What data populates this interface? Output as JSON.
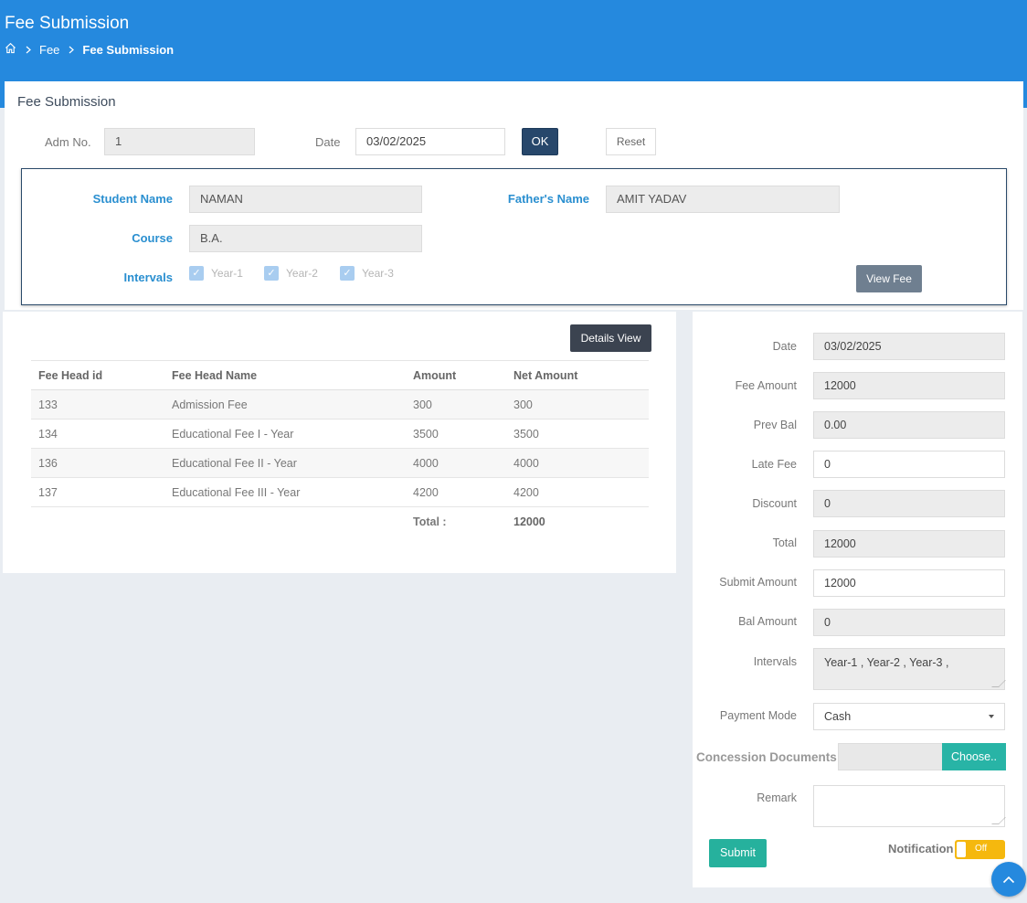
{
  "header": {
    "title": "Fee Submission",
    "breadcrumb": {
      "home_icon": "home-icon",
      "items": [
        "Fee",
        "Fee Submission"
      ]
    }
  },
  "search": {
    "title": "Fee Submission",
    "adm_label": "Adm No.",
    "adm_value": "1",
    "date_label": "Date",
    "date_value": "03/02/2025",
    "ok_label": "OK",
    "reset_label": "Reset"
  },
  "student": {
    "name_label": "Student Name",
    "name_value": "NAMAN",
    "father_label": "Father's Name",
    "father_value": "AMIT YADAV",
    "course_label": "Course",
    "course_value": "B.A.",
    "intervals_label": "Intervals",
    "intervals": [
      {
        "label": "Year-1",
        "checked": true
      },
      {
        "label": "Year-2",
        "checked": true
      },
      {
        "label": "Year-3",
        "checked": true
      }
    ],
    "view_fee_label": "View Fee"
  },
  "fee_table": {
    "details_view_label": "Details View",
    "columns": [
      "Fee Head id",
      "Fee Head Name",
      "Amount",
      "Net Amount"
    ],
    "rows": [
      [
        "133",
        "Admission Fee",
        "300",
        "300"
      ],
      [
        "134",
        "Educational Fee I - Year",
        "3500",
        "3500"
      ],
      [
        "136",
        "Educational Fee II - Year",
        "4000",
        "4000"
      ],
      [
        "137",
        "Educational Fee III - Year",
        "4200",
        "4200"
      ]
    ],
    "total_label": "Total :",
    "total_value": "12000"
  },
  "payment": {
    "date_label": "Date",
    "date_value": "03/02/2025",
    "fee_amount_label": "Fee Amount",
    "fee_amount_value": "12000",
    "prev_bal_label": "Prev Bal",
    "prev_bal_value": "0.00",
    "late_fee_label": "Late Fee",
    "late_fee_value": "0",
    "discount_label": "Discount",
    "discount_value": "0",
    "total_label": "Total",
    "total_value": "12000",
    "submit_amount_label": "Submit Amount",
    "submit_amount_value": "12000",
    "bal_amount_label": "Bal Amount",
    "bal_amount_value": "0",
    "intervals_label": "Intervals",
    "intervals_value": "Year-1 , Year-2 , Year-3 ,",
    "payment_mode_label": "Payment Mode",
    "payment_mode_value": "Cash",
    "concession_label": "Concession Documents",
    "choose_label": "Choose..",
    "remark_label": "Remark",
    "remark_value": "",
    "submit_label": "Submit",
    "notification_label": "Notification",
    "notification_state": "Off"
  },
  "colors": {
    "header_bg": "#2589de",
    "accent_teal": "#26b19d",
    "ok_button": "#27476b",
    "toggle_off": "#f5b80e"
  }
}
